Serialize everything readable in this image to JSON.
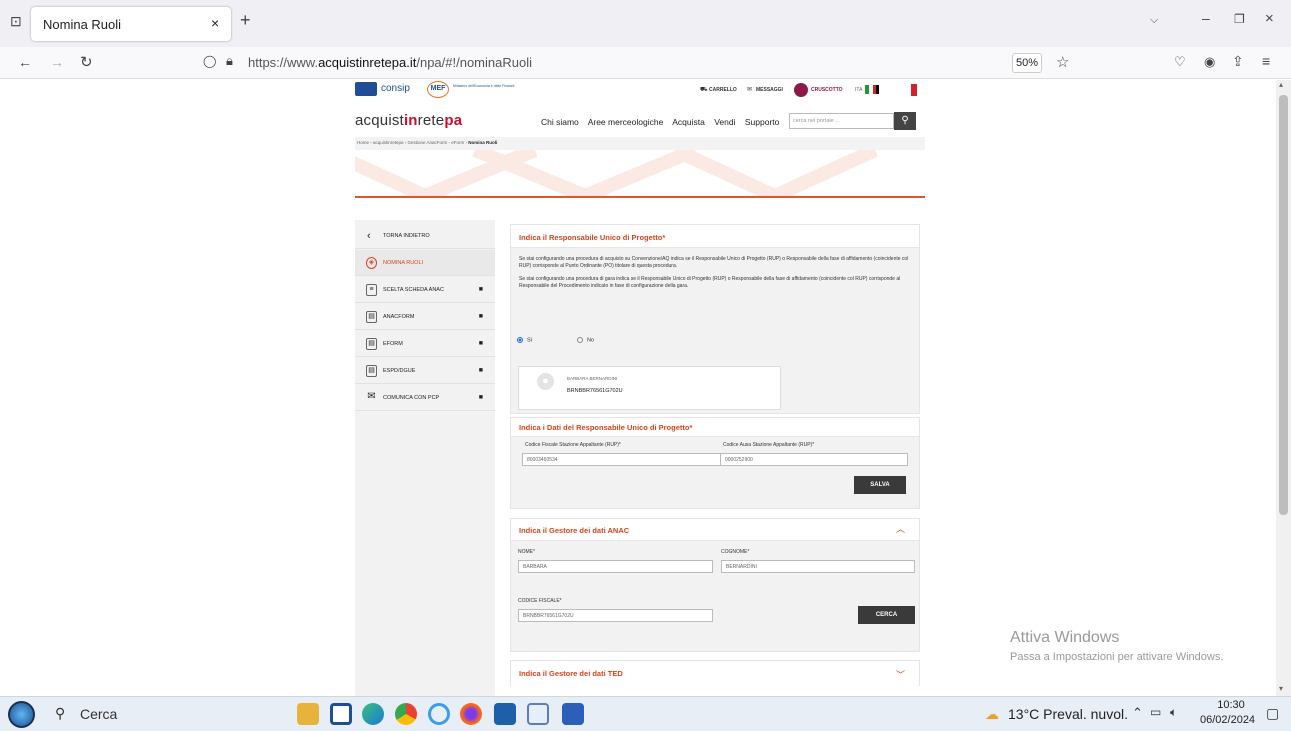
{
  "browser": {
    "tab_title": "Nomina Ruoli",
    "new_tab": "+",
    "url_prefix": "https://www.",
    "url_domain": "acquistinretepa.it",
    "url_path": "/npa/#!/nominaRuoli",
    "zoom": "50%"
  },
  "site": {
    "consip": "consip",
    "mef": "MEF",
    "mef_sub": "Ministero dell'Economia e delle Finanze",
    "carrello": "CARRELLO",
    "messaggi": "MESSAGGI",
    "cruscotto": "CRUSCOTTO",
    "lang": "ITA",
    "brand_a": "acquist",
    "brand_b": "in",
    "brand_c": "rete",
    "brand_d": "pa",
    "menu": [
      "Chi siamo",
      "Aree merceologiche",
      "Acquista",
      "Vendi",
      "Supporto"
    ],
    "search_placeholder": "cerca nel portale ...",
    "breadcrumb": "Home › acquistinretepa › Gestione AnacForm - eForm › ",
    "breadcrumb_current": "Nomina Ruoli"
  },
  "sidebar": {
    "back": "TORNA INDIETRO",
    "items": [
      {
        "label": "NOMINA RUOLI"
      },
      {
        "label": "SCELTA SCHEDA ANAC"
      },
      {
        "label": "ANACFORM"
      },
      {
        "label": "EFORM"
      },
      {
        "label": "ESPD/DGUE"
      },
      {
        "label": "COMUNICA CON PCP"
      }
    ]
  },
  "rup": {
    "title": "Indica il Responsabile Unico di Progetto*",
    "text1": "Se stai configurando una procedura di acquisto su Convenzione/AQ indica se il Responsabile Unico di Progetto (RUP) o Responsabile della fase di affidamento (coincidente col RUP) corrisponde al Punto Ordinante (PO) titolare di questa procedura.",
    "text2": "Se stai configurando una procedura di gara indica se il Responsabile Unico di Progetto (RUP) o Responsabile della fase di affidamento (coincidente col RUP) corrisponde al Responsabile del Procedimento indicato in fase di configurazione della gara.",
    "si": "Sì",
    "no": "No",
    "person_name": "BARBARA BERNARDINI",
    "person_cf": "BRNBBR76561G702U"
  },
  "dati": {
    "title": "Indica i Dati del Responsabile Unico di Progetto*",
    "cf_label": "Codice Fiscale Stazione Appaltante (RUP)*",
    "cf_value": "80003460534",
    "ausa_label": "Codice Ausa Stazione Appaltante (RUP)*",
    "ausa_value": "0000252900",
    "save": "SALVA"
  },
  "anac": {
    "title": "Indica il Gestore dei dati ANAC",
    "nome_label": "NOME*",
    "nome_value": "BARBARA",
    "cognome_label": "COGNOME*",
    "cognome_value": "BERNARDINI",
    "cf_label": "CODICE FISCALE*",
    "cf_value": "BRNBBR76561G702U",
    "search": "CERCA"
  },
  "ted": {
    "title": "Indica il Gestore dei dati TED"
  },
  "watermark": {
    "line1": "Attiva Windows",
    "line2": "Passa a Impostazioni per attivare Windows."
  },
  "taskbar": {
    "search": "Cerca",
    "weather": "13°C  Preval. nuvol.",
    "time": "10:30",
    "date": "06/02/2024"
  }
}
